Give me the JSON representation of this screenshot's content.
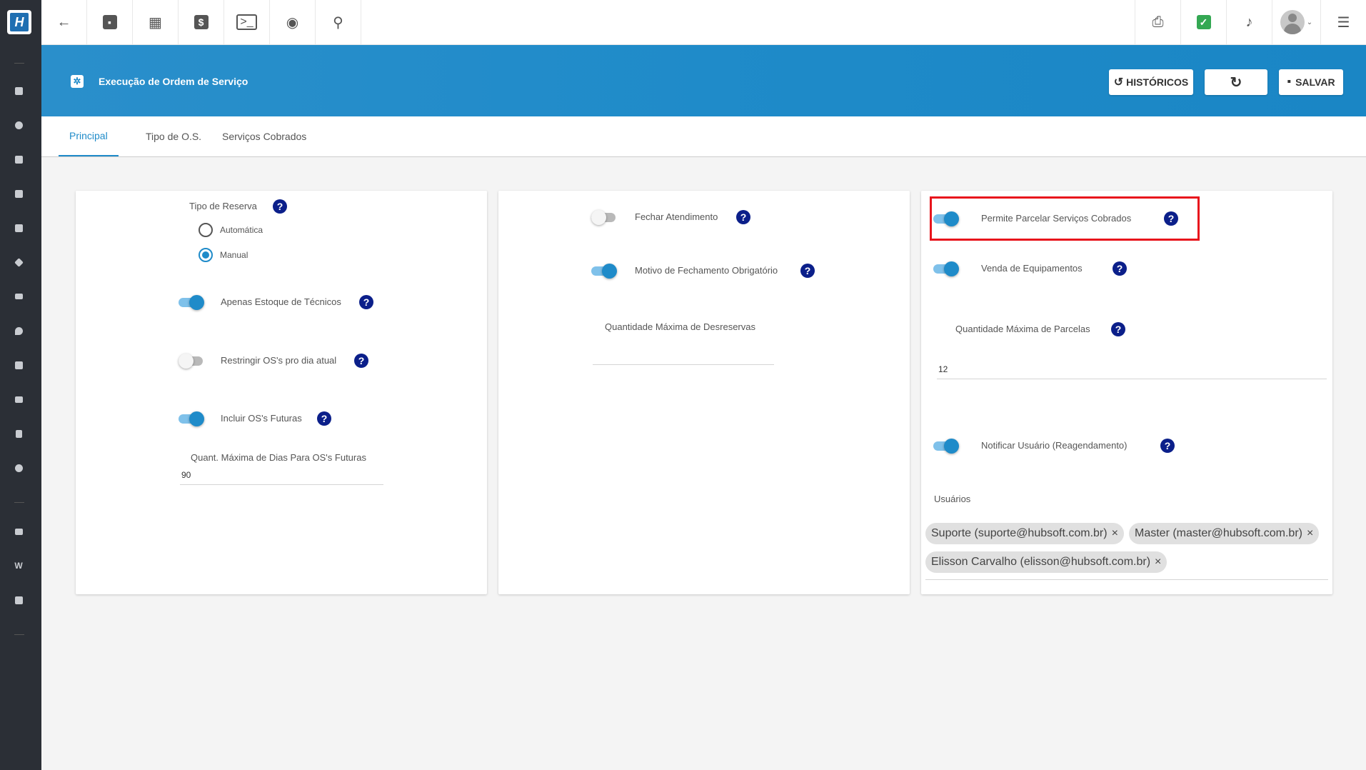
{
  "header": {
    "title": "Execução de Ordem de Serviço",
    "historicos_label": "HISTÓRICOS",
    "salvar_label": "SALVAR"
  },
  "tabs": [
    {
      "label": "Principal",
      "active": true
    },
    {
      "label": "Tipo de O.S.",
      "active": false
    },
    {
      "label": "Serviços Cobrados",
      "active": false
    }
  ],
  "card1": {
    "tipo_reserva_label": "Tipo de Reserva",
    "radio_automatica": "Automática",
    "radio_manual": "Manual",
    "selected": "Manual",
    "apenas_estoque": {
      "label": "Apenas Estoque de Técnicos",
      "on": true
    },
    "restringir": {
      "label": "Restringir OS's pro dia atual",
      "on": false
    },
    "incluir_futuras": {
      "label": "Incluir OS's Futuras",
      "on": true
    },
    "quant_dias_label": "Quant. Máxima de Dias Para OS's Futuras",
    "quant_dias_value": "90"
  },
  "card2": {
    "fechar_atendimento": {
      "label": "Fechar Atendimento",
      "on": false
    },
    "motivo_fechamento": {
      "label": "Motivo de Fechamento Obrigatório",
      "on": true
    },
    "quant_desreservas_label": "Quantidade Máxima de Desreservas",
    "quant_desreservas_value": ""
  },
  "card3": {
    "permite_parcelar": {
      "label": "Permite Parcelar Serviços Cobrados",
      "on": true
    },
    "venda_equipamentos": {
      "label": "Venda de Equipamentos",
      "on": true
    },
    "quant_parcelas_label": "Quantidade Máxima de Parcelas",
    "quant_parcelas_value": "12",
    "notificar_usuario": {
      "label": "Notificar Usuário (Reagendamento)",
      "on": true
    },
    "usuarios_label": "Usuários",
    "usuarios": [
      "Suporte (suporte@hubsoft.com.br)",
      "Master (master@hubsoft.com.br)",
      "Elisson Carvalho (elisson@hubsoft.com.br)"
    ]
  },
  "icons": {
    "help": "?",
    "chip_remove": "×"
  },
  "colors": {
    "primary": "#1f8bc9",
    "help_bg": "#0b1f8a",
    "highlight": "#e8141c",
    "sidebar": "#2b2f36"
  }
}
